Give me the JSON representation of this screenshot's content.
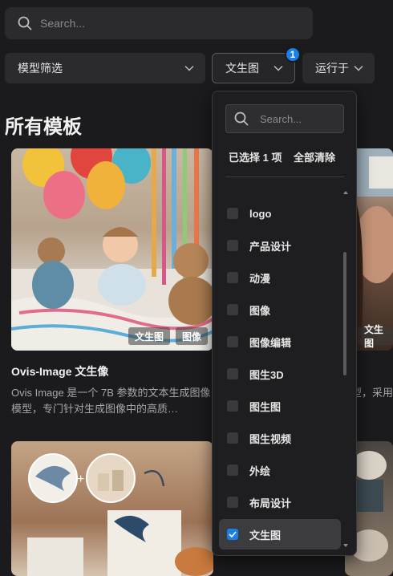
{
  "search": {
    "placeholder": "Search..."
  },
  "filters": {
    "model_filter": "模型筛选",
    "text_to_image": "文生图",
    "runs_on": "运行于",
    "badge_count": "1"
  },
  "section_title": "所有模板",
  "cards": [
    {
      "title": "Ovis-Image 文生像",
      "description": "Ovis Image 是一个 7B 参数的文本生成图像模型，专门针对生成图像中的高质…",
      "tags": [
        "文生图",
        "图像"
      ]
    },
    {
      "tag": "文生图",
      "description_partial_1": "型，采用",
      "description_partial_2": ""
    }
  ],
  "dropdown": {
    "search_placeholder": "Search...",
    "selected_summary": "已选择 1 项",
    "clear_all": "全部清除",
    "options": [
      {
        "label": "logo",
        "checked": false
      },
      {
        "label": "产品设计",
        "checked": false
      },
      {
        "label": "动漫",
        "checked": false
      },
      {
        "label": "图像",
        "checked": false
      },
      {
        "label": "图像编辑",
        "checked": false
      },
      {
        "label": "图生3D",
        "checked": false
      },
      {
        "label": "图生图",
        "checked": false
      },
      {
        "label": "图生视频",
        "checked": false
      },
      {
        "label": "外绘",
        "checked": false
      },
      {
        "label": "布局设计",
        "checked": false
      },
      {
        "label": "文生图",
        "checked": true
      }
    ]
  },
  "colors": {
    "accent": "#1a7fe6",
    "background": "#1b1b1d",
    "panel": "#2b2b2e"
  }
}
